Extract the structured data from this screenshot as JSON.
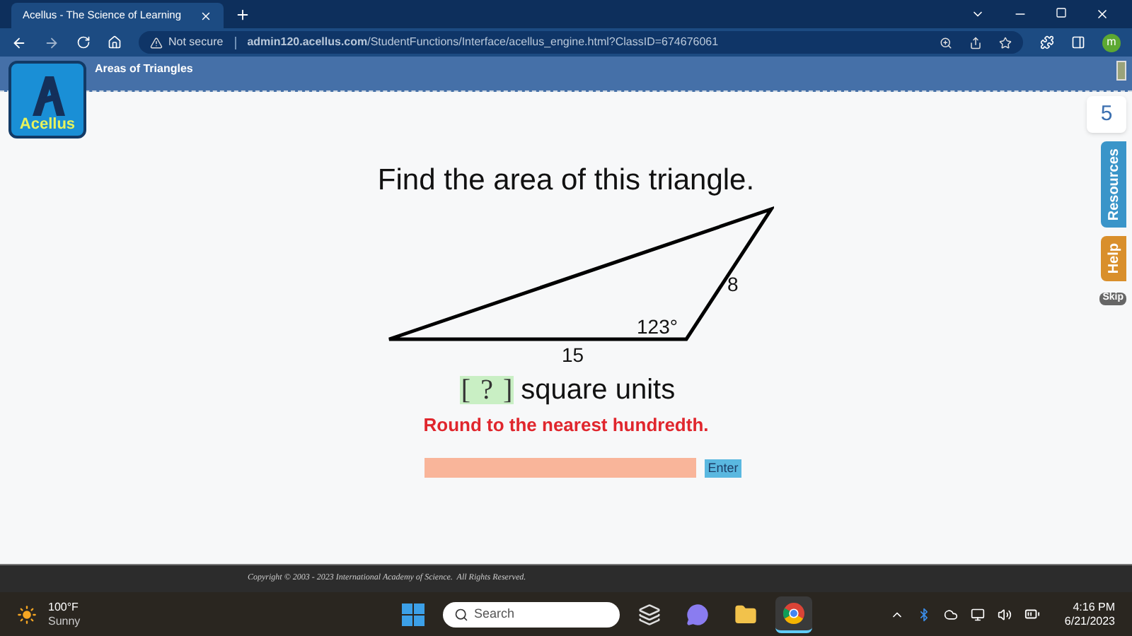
{
  "browser": {
    "tab_title": "Acellus - The Science of Learning",
    "security": "Not secure",
    "url": "**admin120.acellus.com**/StudentFunctions/Interface/acellus_engine.html?ClassID=674676061",
    "profile": "m"
  },
  "app": {
    "logo": "Acellus",
    "lesson_title": "Areas of Triangles",
    "counter": "5",
    "side_tabs": [
      {
        "label": "Resources",
        "color": "#3a95c9"
      },
      {
        "label": "Help",
        "color": "#d98f2b"
      }
    ],
    "skip": "Skip"
  },
  "problem": {
    "question": "Find the area of this triangle.",
    "figure": {
      "side": "8",
      "angle": "123°",
      "base": "15"
    },
    "answer": {
      "open": "[",
      "blank": "?",
      "close": "]",
      "units": "square units"
    },
    "instruction": "Round to the nearest hundredth.",
    "button": "Enter"
  },
  "footer": {
    "copyright": "Copyright © 2003 - 2023 International Academy of Science.  All Rights Reserved."
  },
  "taskbar": {
    "temperature": "100°F",
    "condition": "Sunny",
    "search_placeholder": "Search",
    "apps": [
      {
        "kind": "start",
        "selected": false
      },
      {
        "kind": "windows",
        "selected": false
      },
      {
        "kind": "chat",
        "selected": false
      },
      {
        "kind": "files",
        "selected": false
      },
      {
        "kind": "browser",
        "selected": true
      }
    ],
    "time": "4:16 PM",
    "date": "6/21/2023"
  }
}
